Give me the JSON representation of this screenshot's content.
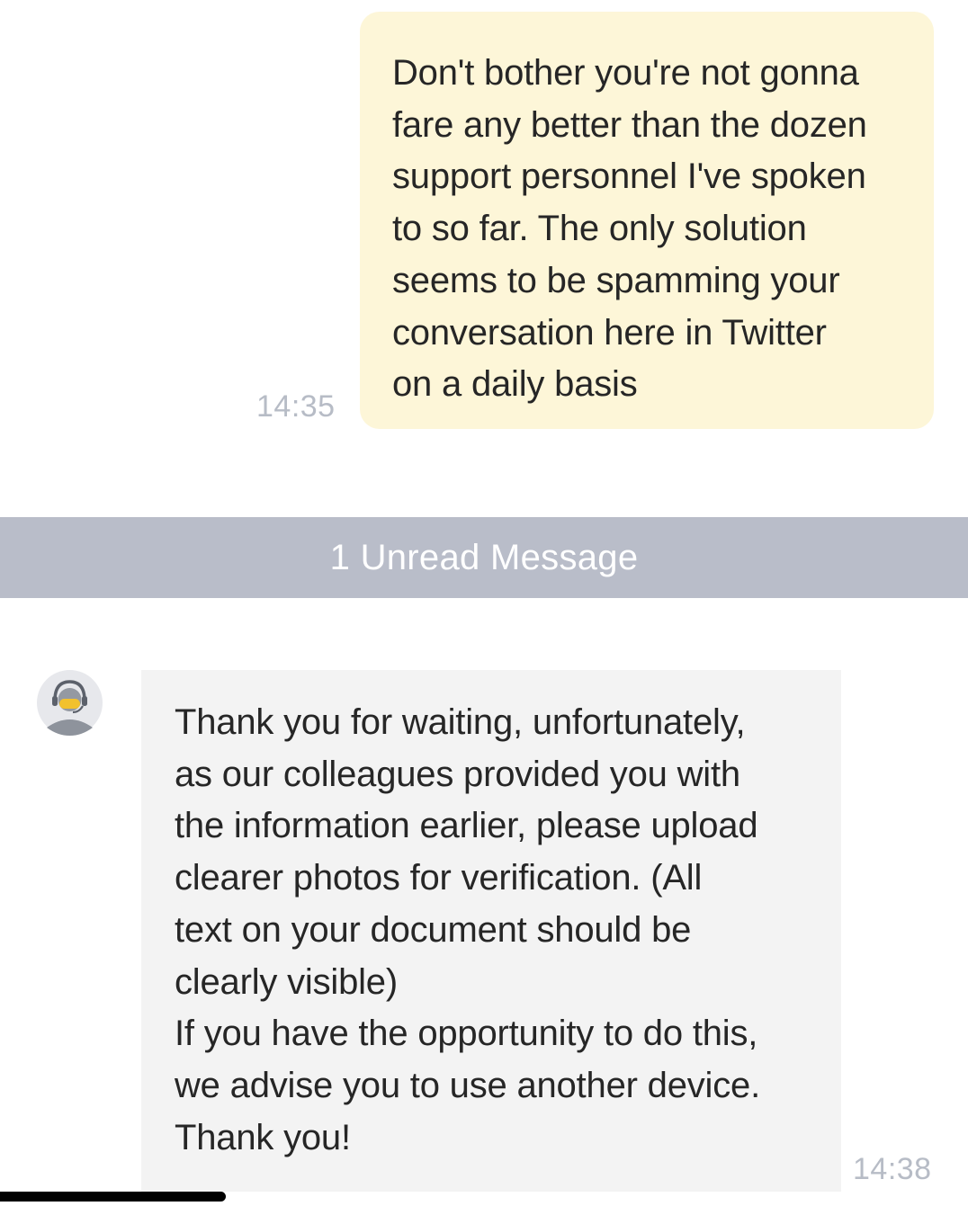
{
  "outgoing_message": {
    "text": "Don't bother you're not gonna\nfare any better than the dozen\nsupport personnel I've spoken\nto so far. The only solution\nseems to be spamming your\nconversation here in Twitter\non a daily basis",
    "time": "14:35"
  },
  "unread_divider": {
    "label": "1 Unread Message"
  },
  "incoming_message": {
    "avatar_icon": "support-agent-icon",
    "text": "Thank you for waiting, unfortunately,\nas our colleagues provided you with\nthe information earlier, please upload\nclearer photos for verification. (All\ntext on your document should be\nclearly visible)\nIf you have the opportunity to do this,\nwe advise you to use another device.\nThank you!",
    "time": "14:38"
  },
  "colors": {
    "outgoing_bubble": "#fdf6d8",
    "incoming_bubble": "#f3f3f3",
    "unread_bar": "#b9bdc9",
    "timestamp": "#b7bcc6",
    "avatar_accent": "#f2c12e"
  }
}
